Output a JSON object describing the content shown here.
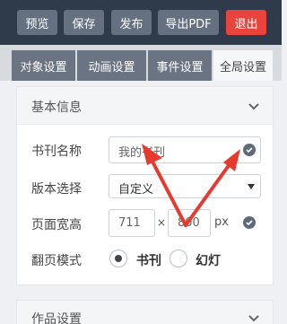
{
  "toolbar": {
    "preview": "预览",
    "save": "保存",
    "publish": "发布",
    "export_pdf": "导出PDF",
    "exit": "退出"
  },
  "tabs": [
    {
      "label": "对象设置",
      "active": false
    },
    {
      "label": "动画设置",
      "active": false
    },
    {
      "label": "事件设置",
      "active": false
    },
    {
      "label": "全局设置",
      "active": true
    }
  ],
  "basic_info": {
    "title": "基本信息",
    "book_name_label": "书刊名称",
    "book_name_value": "我的书刊",
    "version_label": "版本选择",
    "version_value": "自定义",
    "page_size_label": "页面宽高",
    "width_value": "711",
    "times": "×",
    "height_value": "800",
    "unit": "px",
    "flip_mode_label": "翻页模式",
    "flip_options": [
      "书刊",
      "幻灯"
    ],
    "flip_selected": "书刊"
  },
  "works_settings": {
    "title": "作品设置"
  },
  "colors": {
    "topbar": "#2f3a4a",
    "exit": "#e8443d",
    "arrow": "#e8392f"
  }
}
